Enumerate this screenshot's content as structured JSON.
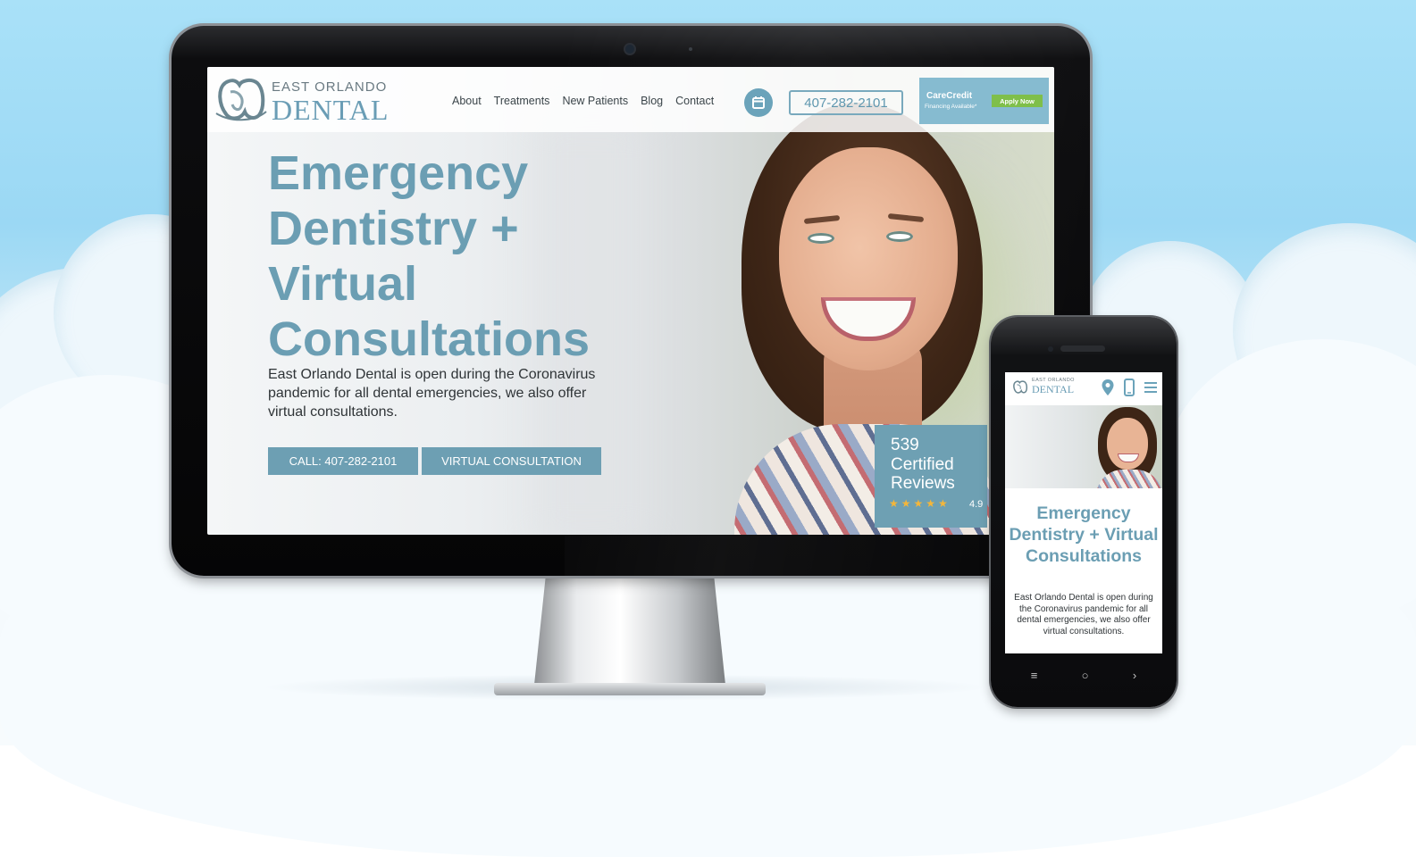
{
  "site": {
    "logo_top": "EAST ORLANDO",
    "logo_main": "DENTAL",
    "nav": [
      "About",
      "Treatments",
      "New Patients",
      "Blog",
      "Contact"
    ],
    "phone": "407-282-2101",
    "carecredit": {
      "name": "CareCredit",
      "sub": "Financing Available*",
      "apply": "Apply Now"
    }
  },
  "hero": {
    "title": "Emergency Dentistry + Virtual Consultations",
    "lead": "East Orlando Dental is open during the Coronavirus pandemic for all dental emergencies, we also offer virtual consultations.",
    "call_button": "CALL: 407-282-2101",
    "virtual_button": "VIRTUAL CONSULTATION"
  },
  "reviews": {
    "count": "539",
    "label": "Certified Reviews",
    "stars": "★★★★★",
    "rating": "4.9"
  },
  "mobile": {
    "logo_top": "EAST ORLANDO",
    "logo_main": "DENTAL",
    "title": "Emergency Dentistry + Virtual Consultations",
    "lead": "East Orlando Dental is open during the Coronavirus pandemic for all dental emergencies, we also offer virtual consultations.",
    "nav_menu": "≡",
    "nav_home": "○",
    "nav_back": "›"
  },
  "colors": {
    "brand_blue": "#6b9eb3",
    "carecredit_bg": "#86bbd0",
    "apply_green": "#7fbf4a",
    "star": "#f4b63a"
  }
}
